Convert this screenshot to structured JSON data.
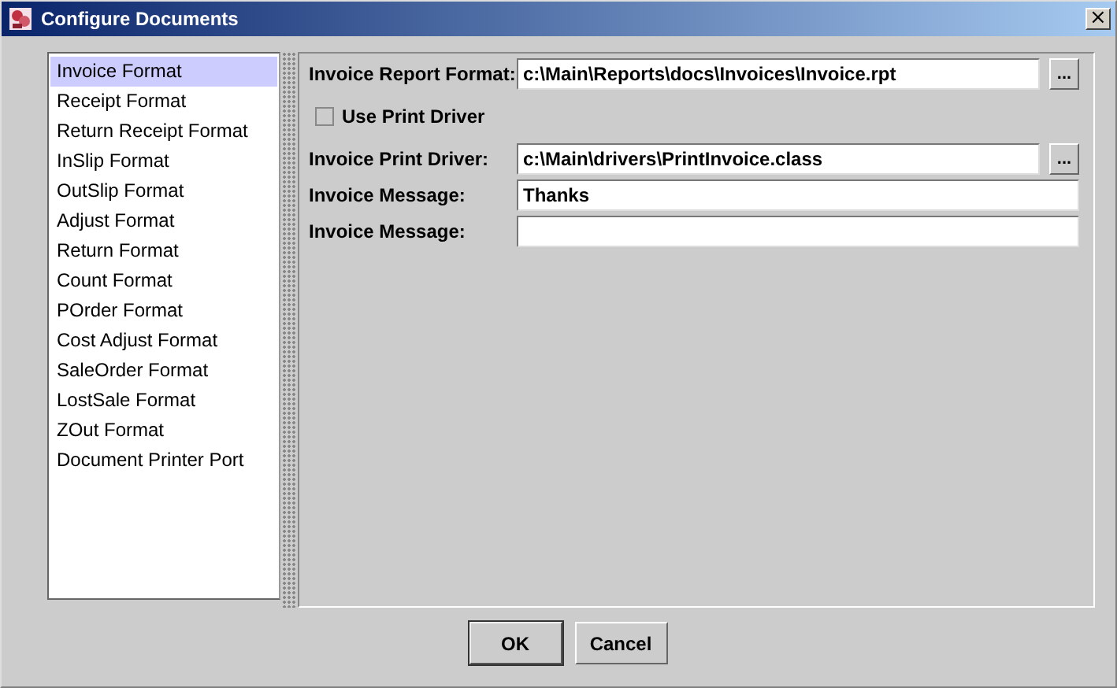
{
  "window": {
    "title": "Configure Documents",
    "close": "×"
  },
  "documents": [
    {
      "label": "Invoice Format",
      "selected": true
    },
    {
      "label": "Receipt Format",
      "selected": false
    },
    {
      "label": "Return Receipt Format",
      "selected": false
    },
    {
      "label": "InSlip Format",
      "selected": false
    },
    {
      "label": "OutSlip Format",
      "selected": false
    },
    {
      "label": "Adjust Format",
      "selected": false
    },
    {
      "label": "Return Format",
      "selected": false
    },
    {
      "label": "Count Format",
      "selected": false
    },
    {
      "label": "POrder Format",
      "selected": false
    },
    {
      "label": "Cost Adjust Format",
      "selected": false
    },
    {
      "label": "SaleOrder Format",
      "selected": false
    },
    {
      "label": "LostSale Format",
      "selected": false
    },
    {
      "label": "ZOut Format",
      "selected": false
    },
    {
      "label": "Document Printer Port",
      "selected": false
    }
  ],
  "settings": [
    {
      "kind": "field",
      "label": "Invoice Report Format:",
      "value": "c:\\Main\\Reports\\docs\\Invoices\\Invoice.rpt",
      "browse": "..."
    },
    {
      "kind": "checkbox",
      "label": "Use Print Driver",
      "checked": false
    },
    {
      "kind": "field",
      "label": "Invoice Print Driver:",
      "value": "c:\\Main\\drivers\\PrintInvoice.class",
      "browse": "..."
    },
    {
      "kind": "field",
      "label": "Invoice Message:",
      "value": "Thanks"
    },
    {
      "kind": "field",
      "label": "Invoice Message:"
    }
  ],
  "buttons": [
    {
      "label": "OK",
      "default": true
    },
    {
      "label": "Cancel",
      "default": false
    }
  ]
}
